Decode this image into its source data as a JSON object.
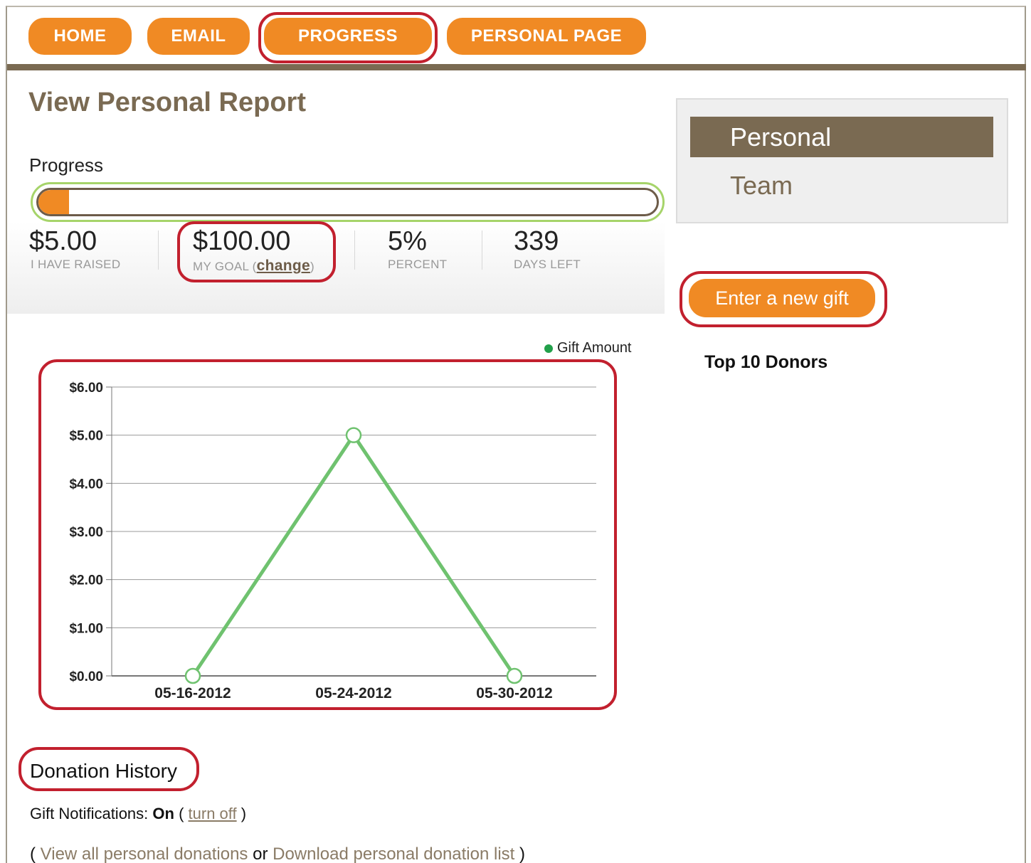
{
  "nav": {
    "items": [
      {
        "label": "HOME"
      },
      {
        "label": "EMAIL"
      },
      {
        "label": "PROGRESS"
      },
      {
        "label": "PERSONAL PAGE"
      }
    ]
  },
  "page": {
    "title": "View Personal Report"
  },
  "progress": {
    "label": "Progress",
    "fraction": 0.05,
    "stats": [
      {
        "value": "$5.00",
        "label": "I HAVE RAISED"
      },
      {
        "value": "$100.00",
        "label": "MY GOAL (",
        "link": "change",
        "suffix": ")"
      },
      {
        "value": "5%",
        "label": "PERCENT"
      },
      {
        "value": "339",
        "label": "DAYS LEFT"
      }
    ]
  },
  "side_nav": {
    "items": [
      {
        "label": "Personal",
        "active": true
      },
      {
        "label": "Team",
        "active": false
      }
    ]
  },
  "gift_button": {
    "label": "Enter a new gift"
  },
  "donors": {
    "title": "Top 10 Donors"
  },
  "chart_data": {
    "type": "line",
    "x": [
      "05-16-2012",
      "05-24-2012",
      "05-30-2012"
    ],
    "series": [
      {
        "name": "Gift Amount",
        "values": [
          0,
          5,
          0
        ],
        "color": "#6fc26f"
      }
    ],
    "y_ticks": [
      "$0.00",
      "$1.00",
      "$2.00",
      "$3.00",
      "$4.00",
      "$5.00",
      "$6.00"
    ],
    "ylim": [
      0,
      6
    ],
    "grid": true,
    "legend_position": "top-right"
  },
  "donation_history": {
    "title": "Donation History",
    "notifications_prefix": "Gift Notifications: ",
    "notifications_state": "On",
    "notifications_open": " ( ",
    "notifications_link": "turn off",
    "notifications_close": " )",
    "links_open": "( ",
    "view_all": "View all personal donations",
    "or": " or ",
    "download": "Download personal donation list",
    "links_close": " )"
  },
  "colors": {
    "accent_orange": "#f08a24",
    "brown": "#7a6a52",
    "highlight_red": "#c2202e",
    "progress_green": "#a6d46a",
    "line_green": "#6fc26f"
  }
}
